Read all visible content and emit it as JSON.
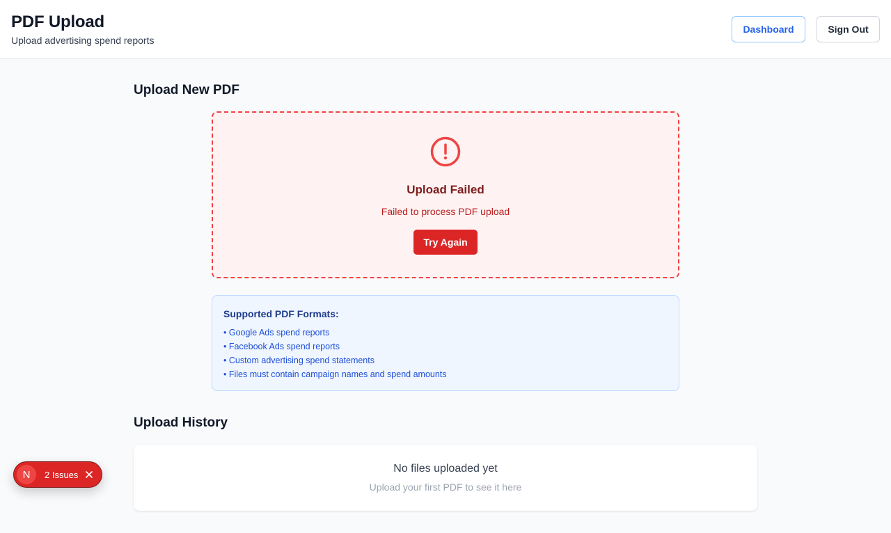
{
  "header": {
    "title": "PDF Upload",
    "subtitle": "Upload advertising spend reports",
    "dashboard_label": "Dashboard",
    "signout_label": "Sign Out"
  },
  "upload": {
    "section_title": "Upload New PDF",
    "status_title": "Upload Failed",
    "status_message": "Failed to process PDF upload",
    "retry_label": "Try Again",
    "icon": "alert-circle-icon"
  },
  "formats": {
    "title": "Supported PDF Formats:",
    "items": [
      "• Google Ads spend reports",
      "• Facebook Ads spend reports",
      "• Custom advertising spend statements",
      "• Files must contain campaign names and spend amounts"
    ]
  },
  "history": {
    "section_title": "Upload History",
    "empty_title": "No files uploaded yet",
    "empty_hint": "Upload your first PDF to see it here"
  },
  "dev_overlay": {
    "logo": "N",
    "issues_label": "2 Issues",
    "close_icon": "close-icon"
  },
  "colors": {
    "error": "#dc2626",
    "error_bg": "#fef2f2",
    "info_bg": "#eff6ff",
    "accent": "#2563eb"
  }
}
